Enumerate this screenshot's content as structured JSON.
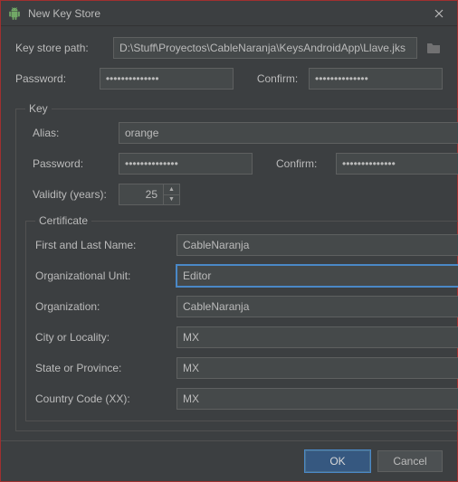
{
  "window": {
    "title": "New Key Store"
  },
  "keystore": {
    "path_label": "Key store path:",
    "path_value": "D:\\Stuff\\Proyectos\\CableNaranja\\KeysAndroidApp\\Llave.jks",
    "password_label": "Password:",
    "password_value": "••••••••••••••",
    "confirm_label": "Confirm:",
    "confirm_value": "••••••••••••••"
  },
  "key": {
    "legend": "Key",
    "alias_label": "Alias:",
    "alias_value": "orange",
    "password_label": "Password:",
    "password_value": "••••••••••••••",
    "confirm_label": "Confirm:",
    "confirm_value": "••••••••••••••",
    "validity_label": "Validity (years):",
    "validity_value": "25"
  },
  "certificate": {
    "legend": "Certificate",
    "first_last_label": "First and Last Name:",
    "first_last_value": "CableNaranja",
    "org_unit_label": "Organizational Unit:",
    "org_unit_value": "Editor",
    "org_label": "Organization:",
    "org_value": "CableNaranja",
    "city_label": "City or Locality:",
    "city_value": "MX",
    "state_label": "State or Province:",
    "state_value": "MX",
    "country_label": "Country Code (XX):",
    "country_value": "MX"
  },
  "buttons": {
    "ok": "OK",
    "cancel": "Cancel"
  }
}
